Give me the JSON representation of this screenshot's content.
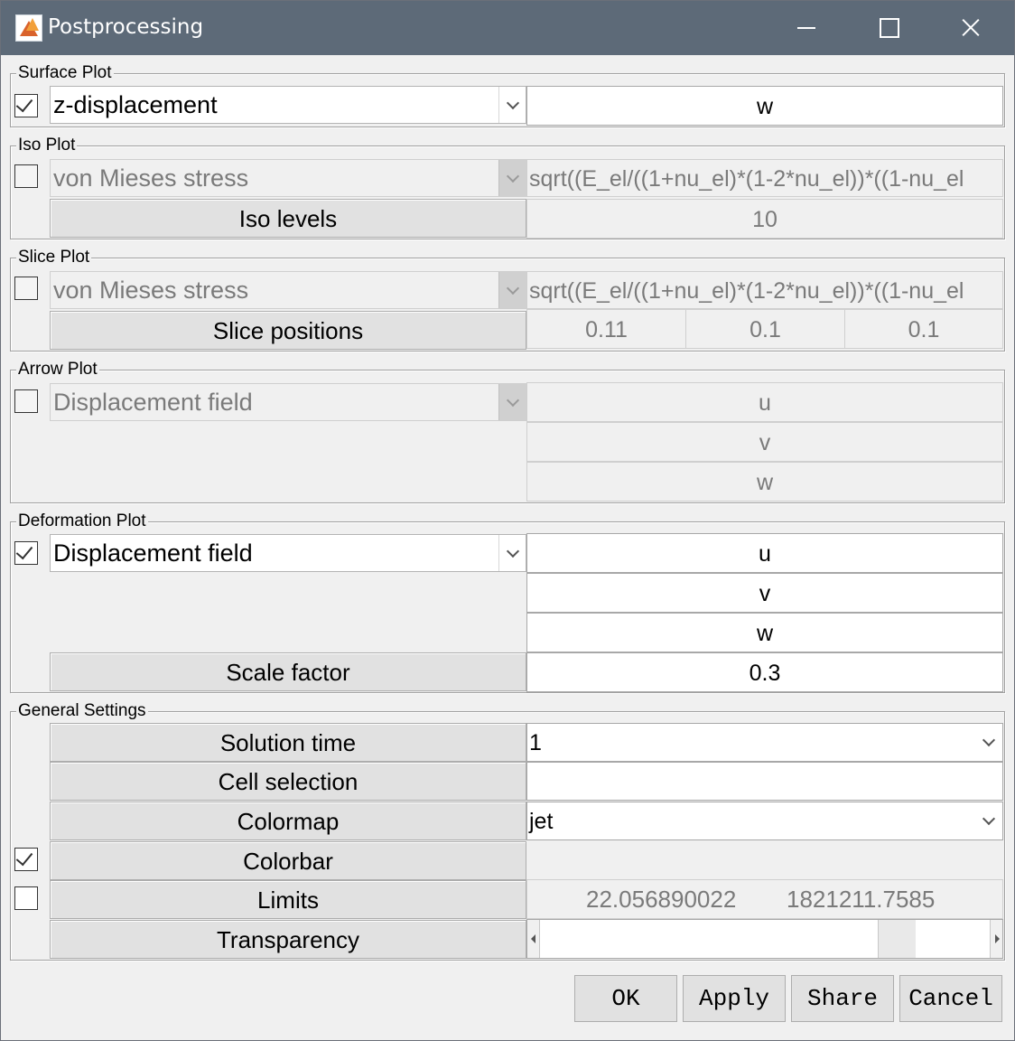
{
  "window": {
    "title": "Postprocessing"
  },
  "surface_plot": {
    "title": "Surface Plot",
    "checked": true,
    "selection": "z-displacement",
    "expression": "w"
  },
  "iso_plot": {
    "title": "Iso Plot",
    "checked": false,
    "selection": "von Mieses stress",
    "expression": "sqrt((E_el/((1+nu_el)*(1-2*nu_el))*((1-nu_el",
    "levels_label": "Iso levels",
    "levels_value": "10"
  },
  "slice_plot": {
    "title": "Slice Plot",
    "checked": false,
    "selection": "von Mieses stress",
    "expression": "sqrt((E_el/((1+nu_el)*(1-2*nu_el))*((1-nu_el",
    "positions_label": "Slice positions",
    "positions": [
      "0.11",
      "0.1",
      "0.1"
    ]
  },
  "arrow_plot": {
    "title": "Arrow Plot",
    "checked": false,
    "selection": "Displacement field",
    "components": [
      "u",
      "v",
      "w"
    ]
  },
  "deformation_plot": {
    "title": "Deformation Plot",
    "checked": true,
    "selection": "Displacement field",
    "components": [
      "u",
      "v",
      "w"
    ],
    "scale_label": "Scale factor",
    "scale_value": "0.3"
  },
  "general_settings": {
    "title": "General Settings",
    "solution_time_label": "Solution time",
    "solution_time_value": "1",
    "cell_selection_label": "Cell selection",
    "cell_selection_value": "",
    "colormap_label": "Colormap",
    "colormap_value": "jet",
    "colorbar_label": "Colorbar",
    "colorbar_checked": true,
    "limits_label": "Limits",
    "limits_checked": false,
    "limits_min": "22.056890022",
    "limits_max": "1821211.7585",
    "transparency_label": "Transparency",
    "transparency_level": 0.82
  },
  "buttons": {
    "ok": "OK",
    "apply": "Apply",
    "share": "Share",
    "cancel": "Cancel"
  },
  "colors": {
    "titlebar": "#5d6a78",
    "background": "#f0f0f0",
    "button": "#e1e1e1"
  }
}
